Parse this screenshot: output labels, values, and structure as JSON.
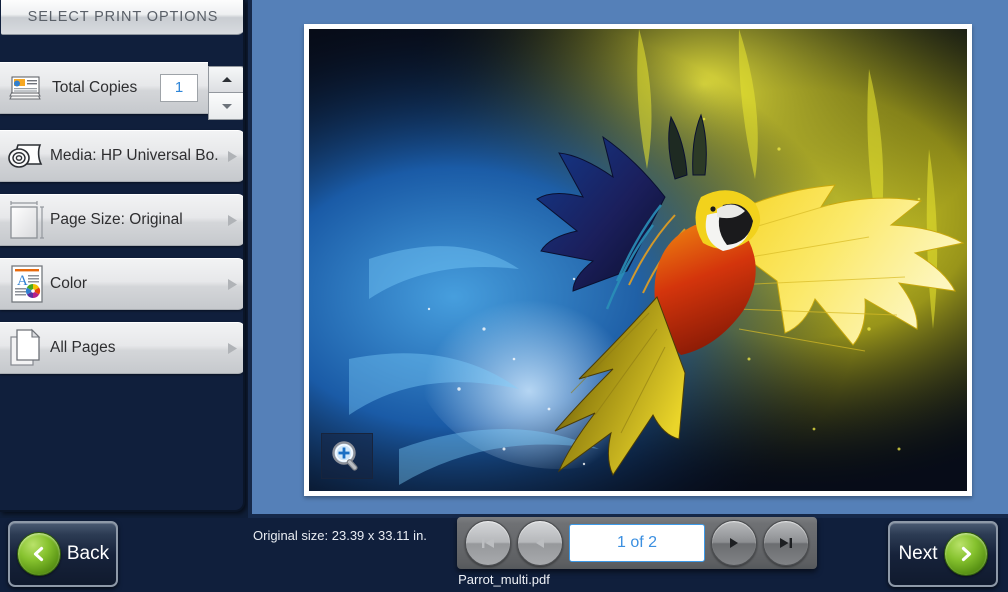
{
  "header": {
    "title": "SELECT PRINT OPTIONS"
  },
  "sidebar": {
    "copies": {
      "label": "Total Copies",
      "value": "1",
      "up_icon": "caret-up-icon",
      "down_icon": "caret-down-icon"
    },
    "items": [
      {
        "label": "Media: HP Universal Bo...",
        "icon": "paper-roll-icon",
        "chevron": "chevron-right-icon"
      },
      {
        "label": "Page Size: Original",
        "icon": "page-size-icon",
        "chevron": "chevron-right-icon"
      },
      {
        "label": "Color",
        "icon": "color-document-icon",
        "chevron": "chevron-right-icon"
      },
      {
        "label": "All Pages",
        "icon": "pages-stack-icon",
        "chevron": "chevron-right-icon"
      }
    ]
  },
  "preview": {
    "zoom_icon": "magnifier-plus-icon",
    "image_alt": "Parrot flying through blue and yellow powder explosion"
  },
  "footer": {
    "original_size": "Original size: 23.39 x 33.11 in.",
    "filename": "Parrot_multi.pdf",
    "page_indicator": "1 of 2",
    "nav": {
      "first_icon": "skip-to-first-icon",
      "prev_icon": "previous-icon",
      "next_icon": "next-icon",
      "last_icon": "skip-to-last-icon"
    },
    "back_label": "Back",
    "next_label": "Next"
  },
  "colors": {
    "panel_dark_blue": "#101f3c",
    "preview_blue": "#5580b8",
    "accent_blue": "#3b8fe0",
    "button_green": "#86c22e"
  }
}
